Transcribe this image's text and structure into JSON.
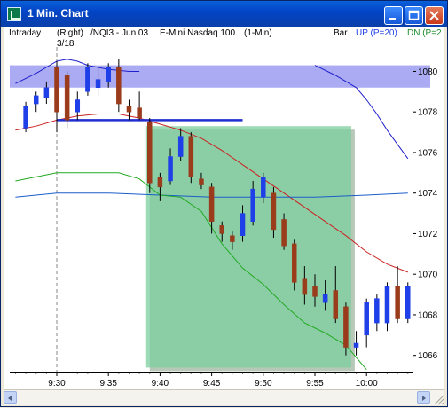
{
  "window": {
    "title": "1  Min. Chart"
  },
  "header": {
    "mode": "Intraday",
    "side": "(Right)",
    "symbol": "/NQI3 - Jun 03",
    "description": "E-Mini Nasdaq 100",
    "interval": "(1-Min)",
    "date_label": "3/18",
    "bar_label": "Bar",
    "up_label": "UP (P=20)",
    "dn_label": "DN (P=2"
  },
  "colors": {
    "up_candle": "#1f3fe8",
    "down_candle": "#9a3c1c",
    "resistance_band": "#8888ee",
    "highlight_box": "#7ccf9f",
    "upper_band": "#2020cc",
    "red_line": "#cc2222",
    "green_line": "#22aa22",
    "blue_midline": "#1a5fc8"
  },
  "chart_data": {
    "type": "candlestick",
    "x_ticks": [
      "9:30",
      "9:35",
      "9:40",
      "9:45",
      "9:50",
      "9:55",
      "10:00"
    ],
    "y_ticks": [
      "1066",
      "1068",
      "1070",
      "1072",
      "1074",
      "1076",
      "1078",
      "1080"
    ],
    "ylim": [
      1065.2,
      1081.2
    ],
    "date_marker_time": "9:30",
    "resistance_band": [
      1079.2,
      1080.3
    ],
    "support_line": {
      "level": 1077.6,
      "from": "9:30",
      "to": "9:48"
    },
    "highlight_region": {
      "from": "9:39",
      "to": "9:58",
      "low": 1065.4,
      "high": 1077.3
    },
    "candles": [
      {
        "t": "9:27",
        "o": 1077.2,
        "h": 1078.5,
        "l": 1077.0,
        "c": 1078.3
      },
      {
        "t": "9:28",
        "o": 1078.4,
        "h": 1079.0,
        "l": 1078.0,
        "c": 1078.8
      },
      {
        "t": "9:29",
        "o": 1078.7,
        "h": 1079.5,
        "l": 1078.4,
        "c": 1079.2
      },
      {
        "t": "9:30",
        "o": 1080.2,
        "h": 1080.5,
        "l": 1077.0,
        "c": 1078.0
      },
      {
        "t": "9:31",
        "o": 1079.8,
        "h": 1080.0,
        "l": 1077.2,
        "c": 1077.6
      },
      {
        "t": "9:32",
        "o": 1078.0,
        "h": 1079.0,
        "l": 1077.6,
        "c": 1078.6
      },
      {
        "t": "9:33",
        "o": 1079.0,
        "h": 1080.4,
        "l": 1078.8,
        "c": 1080.2
      },
      {
        "t": "9:34",
        "o": 1079.2,
        "h": 1080.2,
        "l": 1078.8,
        "c": 1079.6
      },
      {
        "t": "9:35",
        "o": 1079.5,
        "h": 1080.4,
        "l": 1079.2,
        "c": 1080.2
      },
      {
        "t": "9:36",
        "o": 1080.2,
        "h": 1080.6,
        "l": 1078.0,
        "c": 1078.4
      },
      {
        "t": "9:37",
        "o": 1078.3,
        "h": 1078.6,
        "l": 1077.6,
        "c": 1078.0
      },
      {
        "t": "9:38",
        "o": 1078.2,
        "h": 1079.0,
        "l": 1077.6,
        "c": 1077.7
      },
      {
        "t": "9:39",
        "o": 1077.5,
        "h": 1077.7,
        "l": 1074.0,
        "c": 1074.5
      },
      {
        "t": "9:40",
        "o": 1074.8,
        "h": 1075.0,
        "l": 1073.6,
        "c": 1074.3
      },
      {
        "t": "9:41",
        "o": 1074.6,
        "h": 1076.2,
        "l": 1074.4,
        "c": 1075.8
      },
      {
        "t": "9:42",
        "o": 1075.8,
        "h": 1077.2,
        "l": 1075.6,
        "c": 1076.8
      },
      {
        "t": "9:43",
        "o": 1076.8,
        "h": 1077.0,
        "l": 1074.5,
        "c": 1074.8
      },
      {
        "t": "9:44",
        "o": 1074.7,
        "h": 1075.0,
        "l": 1074.2,
        "c": 1074.4
      },
      {
        "t": "9:45",
        "o": 1074.3,
        "h": 1074.5,
        "l": 1072.0,
        "c": 1072.6
      },
      {
        "t": "9:46",
        "o": 1072.4,
        "h": 1072.6,
        "l": 1071.6,
        "c": 1072.0
      },
      {
        "t": "9:47",
        "o": 1071.9,
        "h": 1072.1,
        "l": 1071.2,
        "c": 1071.6
      },
      {
        "t": "9:48",
        "o": 1071.9,
        "h": 1073.4,
        "l": 1071.6,
        "c": 1073.0
      },
      {
        "t": "9:49",
        "o": 1072.6,
        "h": 1074.6,
        "l": 1072.4,
        "c": 1074.2
      },
      {
        "t": "9:50",
        "o": 1073.8,
        "h": 1075.0,
        "l": 1073.5,
        "c": 1074.8
      },
      {
        "t": "9:51",
        "o": 1074.0,
        "h": 1074.3,
        "l": 1071.8,
        "c": 1072.2
      },
      {
        "t": "9:52",
        "o": 1072.7,
        "h": 1073.0,
        "l": 1071.2,
        "c": 1071.4
      },
      {
        "t": "9:53",
        "o": 1071.5,
        "h": 1071.7,
        "l": 1069.2,
        "c": 1069.6
      },
      {
        "t": "9:54",
        "o": 1069.8,
        "h": 1070.4,
        "l": 1068.5,
        "c": 1069.0
      },
      {
        "t": "9:55",
        "o": 1069.4,
        "h": 1070.0,
        "l": 1068.4,
        "c": 1068.9
      },
      {
        "t": "9:56",
        "o": 1068.6,
        "h": 1069.7,
        "l": 1068.2,
        "c": 1069.0
      },
      {
        "t": "9:57",
        "o": 1069.2,
        "h": 1070.4,
        "l": 1067.6,
        "c": 1067.8
      },
      {
        "t": "9:58",
        "o": 1068.4,
        "h": 1068.6,
        "l": 1066.0,
        "c": 1066.4
      },
      {
        "t": "9:59",
        "o": 1066.4,
        "h": 1067.2,
        "l": 1066.0,
        "c": 1066.6
      },
      {
        "t": "10:00",
        "o": 1067.0,
        "h": 1068.8,
        "l": 1066.4,
        "c": 1068.6
      },
      {
        "t": "10:01",
        "o": 1067.6,
        "h": 1069.0,
        "l": 1067.2,
        "c": 1068.8
      },
      {
        "t": "10:02",
        "o": 1067.6,
        "h": 1069.6,
        "l": 1067.2,
        "c": 1069.4
      },
      {
        "t": "10:03",
        "o": 1069.4,
        "h": 1070.4,
        "l": 1067.6,
        "c": 1067.8
      },
      {
        "t": "10:04",
        "o": 1067.8,
        "h": 1069.6,
        "l": 1067.6,
        "c": 1069.4
      }
    ],
    "series": [
      {
        "color_key": "upper_band",
        "x": [
          "9:26",
          "9:28",
          "9:30",
          "9:31",
          "9:32",
          "9:33",
          "9:35",
          "9:37",
          "9:38"
        ],
        "y": [
          1079.4,
          1079.9,
          1080.5,
          1080.6,
          1080.5,
          1080.3,
          1080.1,
          1080.0,
          1080.0
        ]
      },
      {
        "color_key": "upper_band",
        "x": [
          "9:55",
          "9:57",
          "9:59",
          "10:00",
          "10:01",
          "10:02",
          "10:03",
          "10:04"
        ],
        "y": [
          1080.3,
          1079.8,
          1079.2,
          1078.6,
          1077.9,
          1077.1,
          1076.4,
          1075.7
        ]
      },
      {
        "color_key": "red_line",
        "x": [
          "9:26",
          "9:28",
          "9:30",
          "9:32",
          "9:34",
          "9:36",
          "9:38",
          "9:40",
          "9:42",
          "9:44",
          "9:46",
          "9:48",
          "9:50",
          "9:52",
          "9:54",
          "9:56",
          "9:58",
          "10:00",
          "10:02",
          "10:04"
        ],
        "y": [
          1077.1,
          1077.3,
          1077.6,
          1077.8,
          1077.9,
          1077.9,
          1077.7,
          1077.4,
          1077.1,
          1076.7,
          1076.1,
          1075.4,
          1074.7,
          1074.0,
          1073.3,
          1072.6,
          1071.9,
          1071.1,
          1070.5,
          1070.1
        ]
      },
      {
        "color_key": "blue_midline",
        "x": [
          "9:26",
          "9:30",
          "9:35",
          "9:40",
          "9:45",
          "9:50",
          "9:55",
          "10:00",
          "10:04"
        ],
        "y": [
          1073.8,
          1074.0,
          1074.0,
          1073.9,
          1073.8,
          1073.8,
          1073.8,
          1073.9,
          1074.0
        ]
      },
      {
        "color_key": "green_line",
        "x": [
          "9:26",
          "9:28",
          "9:30",
          "9:32",
          "9:34",
          "9:36",
          "9:38",
          "9:40",
          "9:42",
          "9:44",
          "9:46",
          "9:48",
          "9:50",
          "9:52",
          "9:54",
          "9:56",
          "9:58",
          "10:00"
        ],
        "y": [
          1074.6,
          1074.8,
          1075.0,
          1075.0,
          1075.0,
          1075.0,
          1074.7,
          1073.9,
          1073.8,
          1073.1,
          1071.5,
          1070.3,
          1069.5,
          1068.5,
          1067.6,
          1067.1,
          1066.5,
          1065.3
        ]
      }
    ]
  }
}
